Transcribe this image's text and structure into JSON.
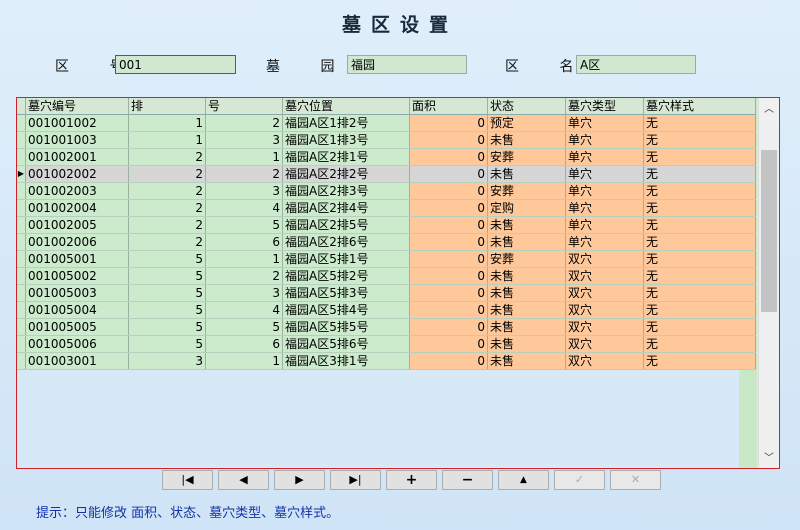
{
  "title": "墓区设置",
  "fields": {
    "zone_no_label": "区 号",
    "zone_no_value": "001",
    "cemetery_label": "墓 园",
    "cemetery_value": "福园",
    "zone_name_label": "区 名",
    "zone_name_value": "A区"
  },
  "grid": {
    "columns": [
      "墓穴编号",
      "排",
      "号",
      "墓穴位置",
      "面积",
      "状态",
      "墓穴类型",
      "墓穴样式"
    ],
    "selected_row": 3,
    "rows": [
      [
        "001001002",
        "1",
        "2",
        "福园A区1排2号",
        "0",
        "预定",
        "单穴",
        "无"
      ],
      [
        "001001003",
        "1",
        "3",
        "福园A区1排3号",
        "0",
        "未售",
        "单穴",
        "无"
      ],
      [
        "001002001",
        "2",
        "1",
        "福园A区2排1号",
        "0",
        "安葬",
        "单穴",
        "无"
      ],
      [
        "001002002",
        "2",
        "2",
        "福园A区2排2号",
        "0",
        "未售",
        "单穴",
        "无"
      ],
      [
        "001002003",
        "2",
        "3",
        "福园A区2排3号",
        "0",
        "安葬",
        "单穴",
        "无"
      ],
      [
        "001002004",
        "2",
        "4",
        "福园A区2排4号",
        "0",
        "定购",
        "单穴",
        "无"
      ],
      [
        "001002005",
        "2",
        "5",
        "福园A区2排5号",
        "0",
        "未售",
        "单穴",
        "无"
      ],
      [
        "001002006",
        "2",
        "6",
        "福园A区2排6号",
        "0",
        "未售",
        "单穴",
        "无"
      ],
      [
        "001005001",
        "5",
        "1",
        "福园A区5排1号",
        "0",
        "安葬",
        "双穴",
        "无"
      ],
      [
        "001005002",
        "5",
        "2",
        "福园A区5排2号",
        "0",
        "未售",
        "双穴",
        "无"
      ],
      [
        "001005003",
        "5",
        "3",
        "福园A区5排3号",
        "0",
        "未售",
        "双穴",
        "无"
      ],
      [
        "001005004",
        "5",
        "4",
        "福园A区5排4号",
        "0",
        "未售",
        "双穴",
        "无"
      ],
      [
        "001005005",
        "5",
        "5",
        "福园A区5排5号",
        "0",
        "未售",
        "双穴",
        "无"
      ],
      [
        "001005006",
        "5",
        "6",
        "福园A区5排6号",
        "0",
        "未售",
        "双穴",
        "无"
      ],
      [
        "001003001",
        "3",
        "1",
        "福园A区3排1号",
        "0",
        "未售",
        "双穴",
        "无"
      ]
    ]
  },
  "navigator": {
    "first": "|◀",
    "prior": "◀",
    "next": "▶",
    "last": "▶|",
    "insert": "+",
    "delete": "−",
    "edit": "▲",
    "post": "✓",
    "cancel": "✕"
  },
  "hint": "提示：只能修改 面积、状态、墓穴类型、墓穴样式。"
}
